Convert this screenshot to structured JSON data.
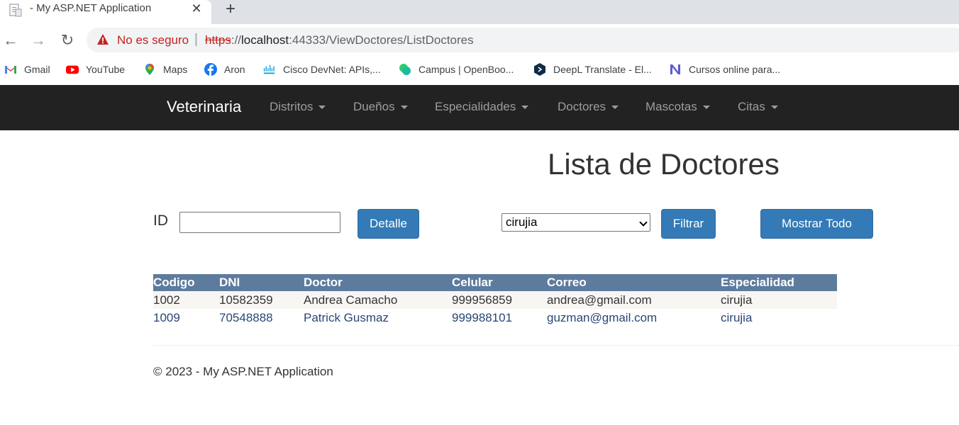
{
  "browser": {
    "tab_title": "- My ASP.NET Application",
    "tab_close": "✕",
    "new_tab": "+",
    "back": "←",
    "forward": "→",
    "reload": "↻",
    "not_secure": "No es seguro",
    "separator": "|",
    "url_scheme": "https",
    "url_sep": "://",
    "url_host": "localhost",
    "url_rest": ":44333/ViewDoctores/ListDoctores",
    "bookmarks": [
      {
        "label": "Gmail",
        "icon": "gmail-icon",
        "color": "#ea4335"
      },
      {
        "label": "YouTube",
        "icon": "youtube-icon",
        "color": "#ff0000"
      },
      {
        "label": "Maps",
        "icon": "maps-icon",
        "color": "#34a853"
      },
      {
        "label": "Aron",
        "icon": "facebook-icon",
        "color": "#1877f2"
      },
      {
        "label": "Cisco DevNet: APIs,...",
        "icon": "cisco-icon",
        "color": "#049fd9"
      },
      {
        "label": "Campus | OpenBoo...",
        "icon": "campus-icon",
        "color": "#2ecc71"
      },
      {
        "label": "DeepL Translate - El...",
        "icon": "deepl-icon",
        "color": "#0f2b46"
      },
      {
        "label": "Cursos online para...",
        "icon": "cursos-icon",
        "color": "#5b5bd6"
      }
    ]
  },
  "navbar": {
    "brand": "Veterinaria",
    "menus": [
      "Distritos",
      "Dueños",
      "Especialidades",
      "Doctores",
      "Mascotas",
      "Citas"
    ]
  },
  "main": {
    "title": "Lista de Doctores",
    "id_label": "ID",
    "id_value": "",
    "detalle_button": "Detalle",
    "select_value": "cirujia",
    "filtrar_button": "Filtrar",
    "mostrar_button": "Mostrar Todo"
  },
  "table": {
    "headers": [
      "Codigo",
      "DNI",
      "Doctor",
      "Celular",
      "Correo",
      "Especialidad"
    ],
    "rows": [
      [
        "1002",
        "10582359",
        "Andrea Camacho",
        "999956859",
        "andrea@gmail.com",
        "cirujia"
      ],
      [
        "1009",
        "70548888",
        "Patrick Gusmaz",
        "999988101",
        "guzman@gmail.com",
        "cirujia"
      ]
    ]
  },
  "footer": {
    "text": "© 2023 - My ASP.NET Application"
  }
}
